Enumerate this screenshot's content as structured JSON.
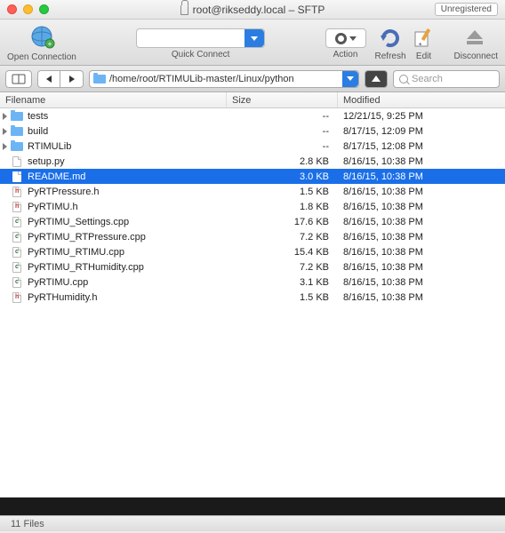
{
  "window": {
    "title": "root@rikseddy.local – SFTP",
    "unregistered": "Unregistered"
  },
  "toolbar": {
    "open": "Open Connection",
    "quick": "Quick Connect",
    "action": "Action",
    "refresh": "Refresh",
    "edit": "Edit",
    "disconnect": "Disconnect"
  },
  "pathbar": {
    "path": "/home/root/RTIMULib-master/Linux/python",
    "search_placeholder": "Search"
  },
  "columns": {
    "name": "Filename",
    "size": "Size",
    "modified": "Modified"
  },
  "files": [
    {
      "type": "folder",
      "name": "tests",
      "size": "--",
      "modified": "12/21/15, 9:25 PM",
      "selected": false
    },
    {
      "type": "folder",
      "name": "build",
      "size": "--",
      "modified": "8/17/15, 12:09 PM",
      "selected": false
    },
    {
      "type": "folder",
      "name": "RTIMULib",
      "size": "--",
      "modified": "8/17/15, 12:08 PM",
      "selected": false
    },
    {
      "type": "doc",
      "name": "setup.py",
      "size": "2.8 KB",
      "modified": "8/16/15, 10:38 PM",
      "selected": false
    },
    {
      "type": "doc",
      "name": "README.md",
      "size": "3.0 KB",
      "modified": "8/16/15, 10:38 PM",
      "selected": true
    },
    {
      "type": "h",
      "name": "PyRTPressure.h",
      "size": "1.5 KB",
      "modified": "8/16/15, 10:38 PM",
      "selected": false
    },
    {
      "type": "h",
      "name": "PyRTIMU.h",
      "size": "1.8 KB",
      "modified": "8/16/15, 10:38 PM",
      "selected": false
    },
    {
      "type": "c",
      "name": "PyRTIMU_Settings.cpp",
      "size": "17.6 KB",
      "modified": "8/16/15, 10:38 PM",
      "selected": false
    },
    {
      "type": "c",
      "name": "PyRTIMU_RTPressure.cpp",
      "size": "7.2 KB",
      "modified": "8/16/15, 10:38 PM",
      "selected": false
    },
    {
      "type": "c",
      "name": "PyRTIMU_RTIMU.cpp",
      "size": "15.4 KB",
      "modified": "8/16/15, 10:38 PM",
      "selected": false
    },
    {
      "type": "c",
      "name": "PyRTIMU_RTHumidity.cpp",
      "size": "7.2 KB",
      "modified": "8/16/15, 10:38 PM",
      "selected": false
    },
    {
      "type": "c",
      "name": "PyRTIMU.cpp",
      "size": "3.1 KB",
      "modified": "8/16/15, 10:38 PM",
      "selected": false
    },
    {
      "type": "h",
      "name": "PyRTHumidity.h",
      "size": "1.5 KB",
      "modified": "8/16/15, 10:38 PM",
      "selected": false
    }
  ],
  "status": {
    "count": "11 Files"
  }
}
